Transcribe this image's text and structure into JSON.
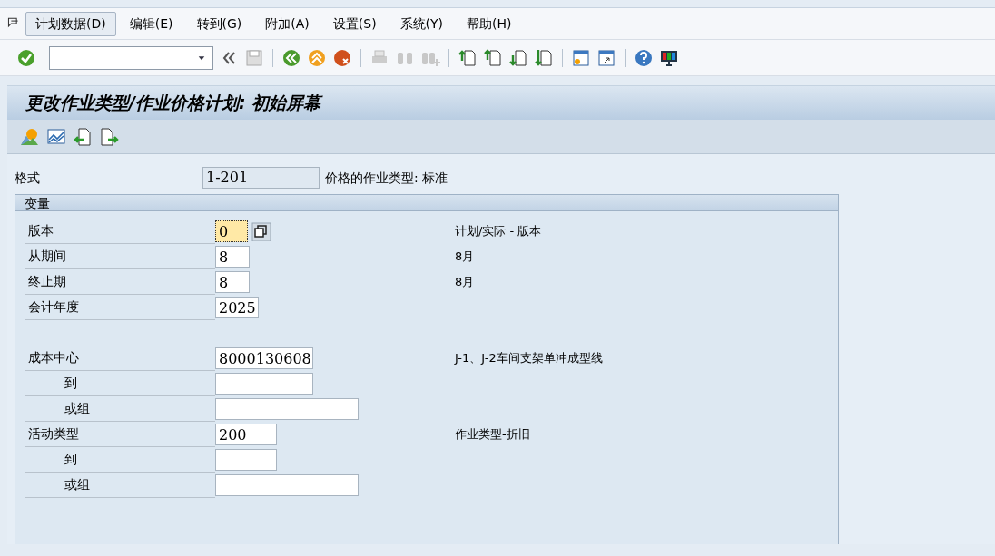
{
  "menu": [
    {
      "label": "计划数据(D)",
      "selected": true
    },
    {
      "label": "编辑(E)",
      "selected": false
    },
    {
      "label": "转到(G)",
      "selected": false
    },
    {
      "label": "附加(A)",
      "selected": false
    },
    {
      "label": "设置(S)",
      "selected": false
    },
    {
      "label": "系统(Y)",
      "selected": false
    },
    {
      "label": "帮助(H)",
      "selected": false
    }
  ],
  "title": "更改作业类型/作业价格计划: 初始屏幕",
  "layout_row": {
    "label": "格式",
    "value": "1-201",
    "description": "价格的作业类型: 标准"
  },
  "group": {
    "title": "变量",
    "rows": [
      {
        "kind": "version",
        "label": "版本",
        "value": "0",
        "description": "计划/实际 - 版本",
        "indent": false,
        "focused": true
      },
      {
        "kind": "period",
        "label": "从期间",
        "value": "8",
        "description": "8月",
        "indent": false,
        "focused": false
      },
      {
        "kind": "period",
        "label": "终止期",
        "value": "8",
        "description": "8月",
        "indent": false,
        "focused": false
      },
      {
        "kind": "year",
        "label": "会计年度",
        "value": "2025",
        "indent": false,
        "focused": false
      },
      {
        "kind": "gap"
      },
      {
        "kind": "costcenter",
        "label": "成本中心",
        "value": "8000130608",
        "description": "J-1、J-2车间支架单冲成型线",
        "indent": false,
        "focused": false
      },
      {
        "kind": "costcenter",
        "label": "到",
        "value": "",
        "indent": true,
        "focused": false
      },
      {
        "kind": "group",
        "label": "或组",
        "value": "",
        "indent": true,
        "focused": false
      },
      {
        "kind": "activity",
        "label": "活动类型",
        "value": "200",
        "description": "作业类型-折旧",
        "indent": false,
        "focused": false
      },
      {
        "kind": "activity",
        "label": "到",
        "value": "",
        "indent": true,
        "focused": false
      },
      {
        "kind": "group",
        "label": "或组",
        "value": "",
        "indent": true,
        "focused": false
      }
    ]
  }
}
